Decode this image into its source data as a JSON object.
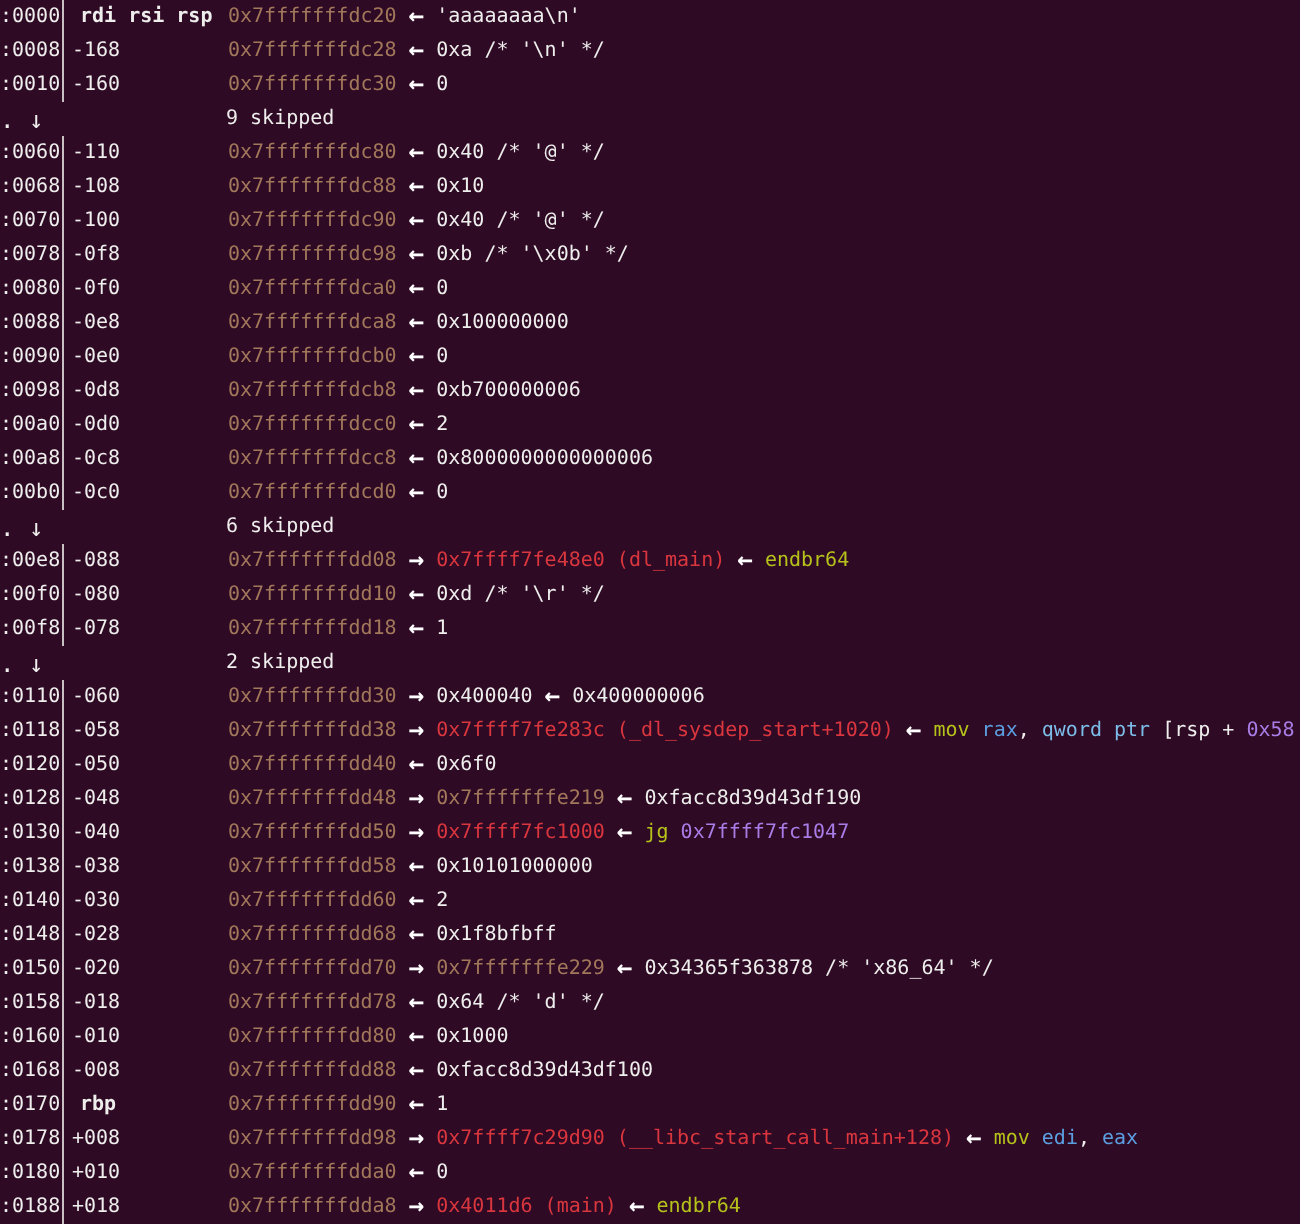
{
  "rows": [
    {
      "kind": "entry",
      "offset": ":0000",
      "label": {
        "kind": "register",
        "text": "rdi rsi rsp"
      },
      "chain": [
        {
          "kind": "stack",
          "text": "0x7fffffffdc20"
        },
        {
          "kind": "arrow",
          "text": "←"
        },
        {
          "kind": "value",
          "text": "'aaaaaaaa\\n'"
        }
      ]
    },
    {
      "kind": "entry",
      "offset": ":0008",
      "label": {
        "kind": "offset",
        "text": "-168"
      },
      "chain": [
        {
          "kind": "stack",
          "text": "0x7fffffffdc28"
        },
        {
          "kind": "arrow",
          "text": "←"
        },
        {
          "kind": "value",
          "text": "0xa /* '\\n' */"
        }
      ]
    },
    {
      "kind": "entry",
      "offset": ":0010",
      "label": {
        "kind": "offset",
        "text": "-160"
      },
      "chain": [
        {
          "kind": "stack",
          "text": "0x7fffffffdc30"
        },
        {
          "kind": "arrow",
          "text": "←"
        },
        {
          "kind": "value",
          "text": "0"
        }
      ]
    },
    {
      "kind": "skip",
      "marker": ". ↓",
      "text": "9 skipped"
    },
    {
      "kind": "entry",
      "offset": ":0060",
      "label": {
        "kind": "offset",
        "text": "-110"
      },
      "chain": [
        {
          "kind": "stack",
          "text": "0x7fffffffdc80"
        },
        {
          "kind": "arrow",
          "text": "←"
        },
        {
          "kind": "value",
          "text": "0x40 /* '@' */"
        }
      ]
    },
    {
      "kind": "entry",
      "offset": ":0068",
      "label": {
        "kind": "offset",
        "text": "-108"
      },
      "chain": [
        {
          "kind": "stack",
          "text": "0x7fffffffdc88"
        },
        {
          "kind": "arrow",
          "text": "←"
        },
        {
          "kind": "value",
          "text": "0x10"
        }
      ]
    },
    {
      "kind": "entry",
      "offset": ":0070",
      "label": {
        "kind": "offset",
        "text": "-100"
      },
      "chain": [
        {
          "kind": "stack",
          "text": "0x7fffffffdc90"
        },
        {
          "kind": "arrow",
          "text": "←"
        },
        {
          "kind": "value",
          "text": "0x40 /* '@' */"
        }
      ]
    },
    {
      "kind": "entry",
      "offset": ":0078",
      "label": {
        "kind": "offset",
        "text": "-0f8"
      },
      "chain": [
        {
          "kind": "stack",
          "text": "0x7fffffffdc98"
        },
        {
          "kind": "arrow",
          "text": "←"
        },
        {
          "kind": "value",
          "text": "0xb /* '\\x0b' */"
        }
      ]
    },
    {
      "kind": "entry",
      "offset": ":0080",
      "label": {
        "kind": "offset",
        "text": "-0f0"
      },
      "chain": [
        {
          "kind": "stack",
          "text": "0x7fffffffdca0"
        },
        {
          "kind": "arrow",
          "text": "←"
        },
        {
          "kind": "value",
          "text": "0"
        }
      ]
    },
    {
      "kind": "entry",
      "offset": ":0088",
      "label": {
        "kind": "offset",
        "text": "-0e8"
      },
      "chain": [
        {
          "kind": "stack",
          "text": "0x7fffffffdca8"
        },
        {
          "kind": "arrow",
          "text": "←"
        },
        {
          "kind": "value",
          "text": "0x100000000"
        }
      ]
    },
    {
      "kind": "entry",
      "offset": ":0090",
      "label": {
        "kind": "offset",
        "text": "-0e0"
      },
      "chain": [
        {
          "kind": "stack",
          "text": "0x7fffffffdcb0"
        },
        {
          "kind": "arrow",
          "text": "←"
        },
        {
          "kind": "value",
          "text": "0"
        }
      ]
    },
    {
      "kind": "entry",
      "offset": ":0098",
      "label": {
        "kind": "offset",
        "text": "-0d8"
      },
      "chain": [
        {
          "kind": "stack",
          "text": "0x7fffffffdcb8"
        },
        {
          "kind": "arrow",
          "text": "←"
        },
        {
          "kind": "value",
          "text": "0xb700000006"
        }
      ]
    },
    {
      "kind": "entry",
      "offset": ":00a0",
      "label": {
        "kind": "offset",
        "text": "-0d0"
      },
      "chain": [
        {
          "kind": "stack",
          "text": "0x7fffffffdcc0"
        },
        {
          "kind": "arrow",
          "text": "←"
        },
        {
          "kind": "value",
          "text": "2"
        }
      ]
    },
    {
      "kind": "entry",
      "offset": ":00a8",
      "label": {
        "kind": "offset",
        "text": "-0c8"
      },
      "chain": [
        {
          "kind": "stack",
          "text": "0x7fffffffdcc8"
        },
        {
          "kind": "arrow",
          "text": "←"
        },
        {
          "kind": "value",
          "text": "0x8000000000000006"
        }
      ]
    },
    {
      "kind": "entry",
      "offset": ":00b0",
      "label": {
        "kind": "offset",
        "text": "-0c0"
      },
      "chain": [
        {
          "kind": "stack",
          "text": "0x7fffffffdcd0"
        },
        {
          "kind": "arrow",
          "text": "←"
        },
        {
          "kind": "value",
          "text": "0"
        }
      ]
    },
    {
      "kind": "skip",
      "marker": ". ↓",
      "text": "6 skipped"
    },
    {
      "kind": "entry",
      "offset": ":00e8",
      "label": {
        "kind": "offset",
        "text": "-088"
      },
      "chain": [
        {
          "kind": "stack",
          "text": "0x7fffffffdd08"
        },
        {
          "kind": "arrow",
          "text": "→"
        },
        {
          "kind": "code",
          "text": "0x7ffff7fe48e0 (dl_main)"
        },
        {
          "kind": "arrow",
          "text": "←"
        },
        {
          "kind": "mnemonic",
          "text": "endbr64"
        }
      ]
    },
    {
      "kind": "entry",
      "offset": ":00f0",
      "label": {
        "kind": "offset",
        "text": "-080"
      },
      "chain": [
        {
          "kind": "stack",
          "text": "0x7fffffffdd10"
        },
        {
          "kind": "arrow",
          "text": "←"
        },
        {
          "kind": "value",
          "text": "0xd /* '\\r' */"
        }
      ]
    },
    {
      "kind": "entry",
      "offset": ":00f8",
      "label": {
        "kind": "offset",
        "text": "-078"
      },
      "chain": [
        {
          "kind": "stack",
          "text": "0x7fffffffdd18"
        },
        {
          "kind": "arrow",
          "text": "←"
        },
        {
          "kind": "value",
          "text": "1"
        }
      ]
    },
    {
      "kind": "skip",
      "marker": ". ↓",
      "text": "2 skipped"
    },
    {
      "kind": "entry",
      "offset": ":0110",
      "label": {
        "kind": "offset",
        "text": "-060"
      },
      "chain": [
        {
          "kind": "stack",
          "text": "0x7fffffffdd30"
        },
        {
          "kind": "arrow",
          "text": "→"
        },
        {
          "kind": "value",
          "text": "0x400040"
        },
        {
          "kind": "arrow",
          "text": "←"
        },
        {
          "kind": "value",
          "text": "0x400000006"
        }
      ]
    },
    {
      "kind": "entry",
      "offset": ":0118",
      "label": {
        "kind": "offset",
        "text": "-058"
      },
      "chain": [
        {
          "kind": "stack",
          "text": "0x7fffffffdd38"
        },
        {
          "kind": "arrow",
          "text": "→"
        },
        {
          "kind": "code",
          "text": "0x7ffff7fe283c (_dl_sysdep_start+1020)"
        },
        {
          "kind": "arrow",
          "text": "←"
        },
        {
          "kind": "mnemonic",
          "text": "mov"
        },
        {
          "kind": "register",
          "text": "rax"
        },
        {
          "kind": "comma",
          "text": ","
        },
        {
          "kind": "size",
          "text": "qword ptr"
        },
        {
          "kind": "value",
          "text": "[rsp +"
        },
        {
          "kind": "number",
          "text": "0x58"
        }
      ]
    },
    {
      "kind": "entry",
      "offset": ":0120",
      "label": {
        "kind": "offset",
        "text": "-050"
      },
      "chain": [
        {
          "kind": "stack",
          "text": "0x7fffffffdd40"
        },
        {
          "kind": "arrow",
          "text": "←"
        },
        {
          "kind": "value",
          "text": "0x6f0"
        }
      ]
    },
    {
      "kind": "entry",
      "offset": ":0128",
      "label": {
        "kind": "offset",
        "text": "-048"
      },
      "chain": [
        {
          "kind": "stack",
          "text": "0x7fffffffdd48"
        },
        {
          "kind": "arrow",
          "text": "→"
        },
        {
          "kind": "stack",
          "text": "0x7fffffffe219"
        },
        {
          "kind": "arrow",
          "text": "←"
        },
        {
          "kind": "value",
          "text": "0xfacc8d39d43df190"
        }
      ]
    },
    {
      "kind": "entry",
      "offset": ":0130",
      "label": {
        "kind": "offset",
        "text": "-040"
      },
      "chain": [
        {
          "kind": "stack",
          "text": "0x7fffffffdd50"
        },
        {
          "kind": "arrow",
          "text": "→"
        },
        {
          "kind": "code",
          "text": "0x7ffff7fc1000"
        },
        {
          "kind": "arrow",
          "text": "←"
        },
        {
          "kind": "mnemonic",
          "text": "jg"
        },
        {
          "kind": "number",
          "text": "0x7ffff7fc1047"
        }
      ]
    },
    {
      "kind": "entry",
      "offset": ":0138",
      "label": {
        "kind": "offset",
        "text": "-038"
      },
      "chain": [
        {
          "kind": "stack",
          "text": "0x7fffffffdd58"
        },
        {
          "kind": "arrow",
          "text": "←"
        },
        {
          "kind": "value",
          "text": "0x10101000000"
        }
      ]
    },
    {
      "kind": "entry",
      "offset": ":0140",
      "label": {
        "kind": "offset",
        "text": "-030"
      },
      "chain": [
        {
          "kind": "stack",
          "text": "0x7fffffffdd60"
        },
        {
          "kind": "arrow",
          "text": "←"
        },
        {
          "kind": "value",
          "text": "2"
        }
      ]
    },
    {
      "kind": "entry",
      "offset": ":0148",
      "label": {
        "kind": "offset",
        "text": "-028"
      },
      "chain": [
        {
          "kind": "stack",
          "text": "0x7fffffffdd68"
        },
        {
          "kind": "arrow",
          "text": "←"
        },
        {
          "kind": "value",
          "text": "0x1f8bfbff"
        }
      ]
    },
    {
      "kind": "entry",
      "offset": ":0150",
      "label": {
        "kind": "offset",
        "text": "-020"
      },
      "chain": [
        {
          "kind": "stack",
          "text": "0x7fffffffdd70"
        },
        {
          "kind": "arrow",
          "text": "→"
        },
        {
          "kind": "stack",
          "text": "0x7fffffffe229"
        },
        {
          "kind": "arrow",
          "text": "←"
        },
        {
          "kind": "value",
          "text": "0x34365f363878 /* 'x86_64' */"
        }
      ]
    },
    {
      "kind": "entry",
      "offset": ":0158",
      "label": {
        "kind": "offset",
        "text": "-018"
      },
      "chain": [
        {
          "kind": "stack",
          "text": "0x7fffffffdd78"
        },
        {
          "kind": "arrow",
          "text": "←"
        },
        {
          "kind": "value",
          "text": "0x64 /* 'd' */"
        }
      ]
    },
    {
      "kind": "entry",
      "offset": ":0160",
      "label": {
        "kind": "offset",
        "text": "-010"
      },
      "chain": [
        {
          "kind": "stack",
          "text": "0x7fffffffdd80"
        },
        {
          "kind": "arrow",
          "text": "←"
        },
        {
          "kind": "value",
          "text": "0x1000"
        }
      ]
    },
    {
      "kind": "entry",
      "offset": ":0168",
      "label": {
        "kind": "offset",
        "text": "-008"
      },
      "chain": [
        {
          "kind": "stack",
          "text": "0x7fffffffdd88"
        },
        {
          "kind": "arrow",
          "text": "←"
        },
        {
          "kind": "value",
          "text": "0xfacc8d39d43df100"
        }
      ]
    },
    {
      "kind": "entry",
      "offset": ":0170",
      "label": {
        "kind": "register",
        "text": "rbp"
      },
      "chain": [
        {
          "kind": "stack",
          "text": "0x7fffffffdd90"
        },
        {
          "kind": "arrow",
          "text": "←"
        },
        {
          "kind": "value",
          "text": "1"
        }
      ]
    },
    {
      "kind": "entry",
      "offset": ":0178",
      "label": {
        "kind": "offset",
        "text": "+008"
      },
      "chain": [
        {
          "kind": "stack",
          "text": "0x7fffffffdd98"
        },
        {
          "kind": "arrow",
          "text": "→"
        },
        {
          "kind": "code",
          "text": "0x7ffff7c29d90 (__libc_start_call_main+128)"
        },
        {
          "kind": "arrow",
          "text": "←"
        },
        {
          "kind": "mnemonic",
          "text": "mov"
        },
        {
          "kind": "register",
          "text": "edi"
        },
        {
          "kind": "comma",
          "text": ","
        },
        {
          "kind": "register",
          "text": "eax"
        }
      ]
    },
    {
      "kind": "entry",
      "offset": ":0180",
      "label": {
        "kind": "offset",
        "text": "+010"
      },
      "chain": [
        {
          "kind": "stack",
          "text": "0x7fffffffdda0"
        },
        {
          "kind": "arrow",
          "text": "←"
        },
        {
          "kind": "value",
          "text": "0"
        }
      ]
    },
    {
      "kind": "entry",
      "offset": ":0188",
      "label": {
        "kind": "offset",
        "text": "+018"
      },
      "chain": [
        {
          "kind": "stack",
          "text": "0x7fffffffdda8"
        },
        {
          "kind": "arrow",
          "text": "→"
        },
        {
          "kind": "code",
          "text": "0x4011d6 (main)"
        },
        {
          "kind": "arrow",
          "text": "←"
        },
        {
          "kind": "mnemonic",
          "text": "endbr64"
        }
      ]
    }
  ]
}
